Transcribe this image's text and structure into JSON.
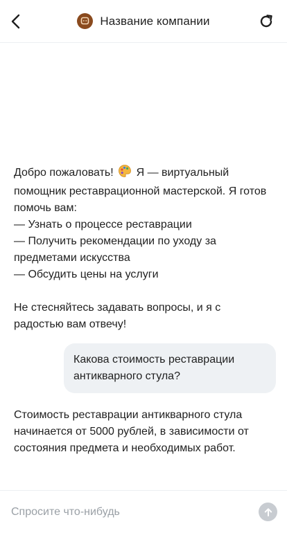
{
  "header": {
    "title": "Название компании",
    "back_icon": "chevron-left-icon",
    "refresh_icon": "refresh-icon",
    "logo_icon": "chat-bubble-icon",
    "logo_color": "#8a4a1e"
  },
  "messages": [
    {
      "role": "assistant",
      "lines": [
        "Добро пожаловать!",
        "Я — виртуальный помощник реставрационной мастерской. Я готов помочь вам:",
        "— Узнать о процессе реставрации",
        "— Получить рекомендации по уходу за предметами искусства",
        "— Обсудить цены на услуги",
        "Не стесняйтесь задавать вопросы, и я с радостью вам отвечу!"
      ],
      "emoji": "palette-emoji"
    },
    {
      "role": "user",
      "text": "Какова стоимость реставрации антикварного стула?"
    },
    {
      "role": "assistant",
      "text": "Стоимость реставрации антикварного стула начинается от 5000 рублей, в зависимости от состояния предмета и необходимых работ."
    }
  ],
  "composer": {
    "placeholder": "Спросите что-нибудь",
    "value": "",
    "send_icon": "arrow-up-icon"
  },
  "colors": {
    "user_bubble": "#eef1f4",
    "send_disabled": "#c8ccd1",
    "divider": "#eceff2"
  }
}
